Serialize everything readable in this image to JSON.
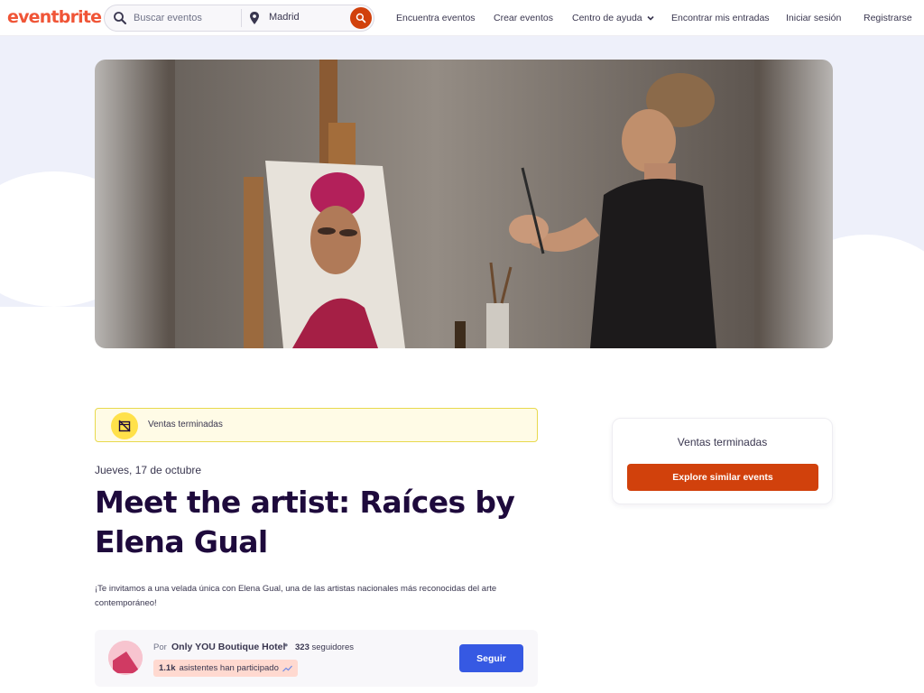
{
  "header": {
    "logo": "eventbrite",
    "search": {
      "placeholder": "Buscar eventos",
      "location": "Madrid"
    },
    "nav": {
      "find_events": "Encuentra eventos",
      "create_events": "Crear eventos",
      "help_center": "Centro de ayuda",
      "find_tickets": "Encontrar mis entradas",
      "login": "Iniciar sesión",
      "signup": "Registrarse"
    }
  },
  "event": {
    "status_banner": "Ventas terminadas",
    "date": "Jueves, 17 de octubre",
    "title": "Meet the artist: Raíces by Elena Gual",
    "summary": "¡Te invitamos a una velada única con Elena Gual, una de las artistas nacionales más reconocidas del arte contemporáneo!"
  },
  "organizer": {
    "by_label": "Por",
    "name": "Only YOU Boutique Hotel",
    "followers_count": "323",
    "followers_label": "seguidores",
    "attendees_count": "1.1k",
    "attendees_label": "asistentes han participado",
    "follow_label": "Seguir"
  },
  "ticket_card": {
    "status": "Ventas terminadas",
    "button_label": "Explore similar events"
  },
  "colors": {
    "brand": "#f05537",
    "primary_action": "#d1410c",
    "follow_button": "#3659e3",
    "banner_bg": "#fffbe6",
    "text_dark": "#1e0a3c"
  }
}
